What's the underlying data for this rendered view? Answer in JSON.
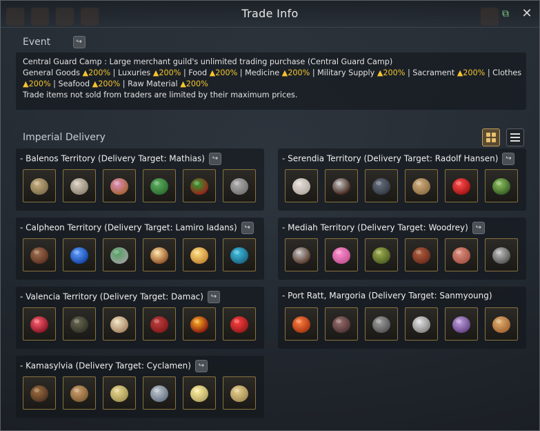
{
  "window": {
    "title": "Trade Info"
  },
  "event": {
    "heading": "Event",
    "line1": "Central Guard Camp : Large merchant guild's unlimited trading purchase (Central Guard Camp)",
    "seg": {
      "general_goods": "General Goods ",
      "luxuries": " | Luxuries ",
      "food": " | Food ",
      "medicine": " | Medicine ",
      "military": " | Military Supply ",
      "sacrament": " | Sacrament ",
      "clothes": " | Clothes",
      "seafood": " | Seafood ",
      "raw": " | Raw Material "
    },
    "rate": "▲200%",
    "footer": "Trade items not sold from traders are limited by their maximum prices."
  },
  "delivery": {
    "heading": "Imperial Delivery",
    "territories": [
      {
        "label": "- Balenos Territory (Delivery Target: Mathias)",
        "items": [
          "statue",
          "stone-block",
          "candle",
          "green-shirt",
          "red-berries",
          "gargoyle-head"
        ]
      },
      {
        "label": "- Serendia Territory (Delivery Target: Radolf Hansen)",
        "items": [
          "chicken",
          "wine-bottle",
          "sack",
          "wooden-plank",
          "red-orbs",
          "green-card"
        ]
      },
      {
        "label": "- Calpheon Territory (Delivery Target: Lamiro Iadans)",
        "items": [
          "book",
          "blue-potion",
          "white-potion",
          "glowing-orb",
          "seashell",
          "blue-coral"
        ]
      },
      {
        "label": "- Mediah Territory (Delivery Target: Woodrey)",
        "items": [
          "bola",
          "pink-dress",
          "logs",
          "doll",
          "meat",
          "metal-claw"
        ]
      },
      {
        "label": "- Valencia Territory (Delivery Target: Damac)",
        "items": [
          "red-potion",
          "telescope",
          "horn",
          "red-book",
          "ruby-ornament",
          "red-scroll"
        ]
      },
      {
        "label": "- Port Ratt, Margoria (Delivery Target: Sanmyoung)",
        "items": [
          "red-leaf",
          "dark-ore",
          "net-bag",
          "oyster",
          "purple-crystal",
          "grain-sack"
        ]
      },
      {
        "label": "- Kamasylvia (Delivery Target: Cyclamen)",
        "items": [
          "lumber",
          "planks",
          "dough",
          "mushrooms",
          "glowing-egg",
          "bread-loaf"
        ]
      }
    ]
  },
  "colors": {
    "accent": "#f3c430",
    "border": "#8a7440",
    "expand": "#7fd08a"
  }
}
